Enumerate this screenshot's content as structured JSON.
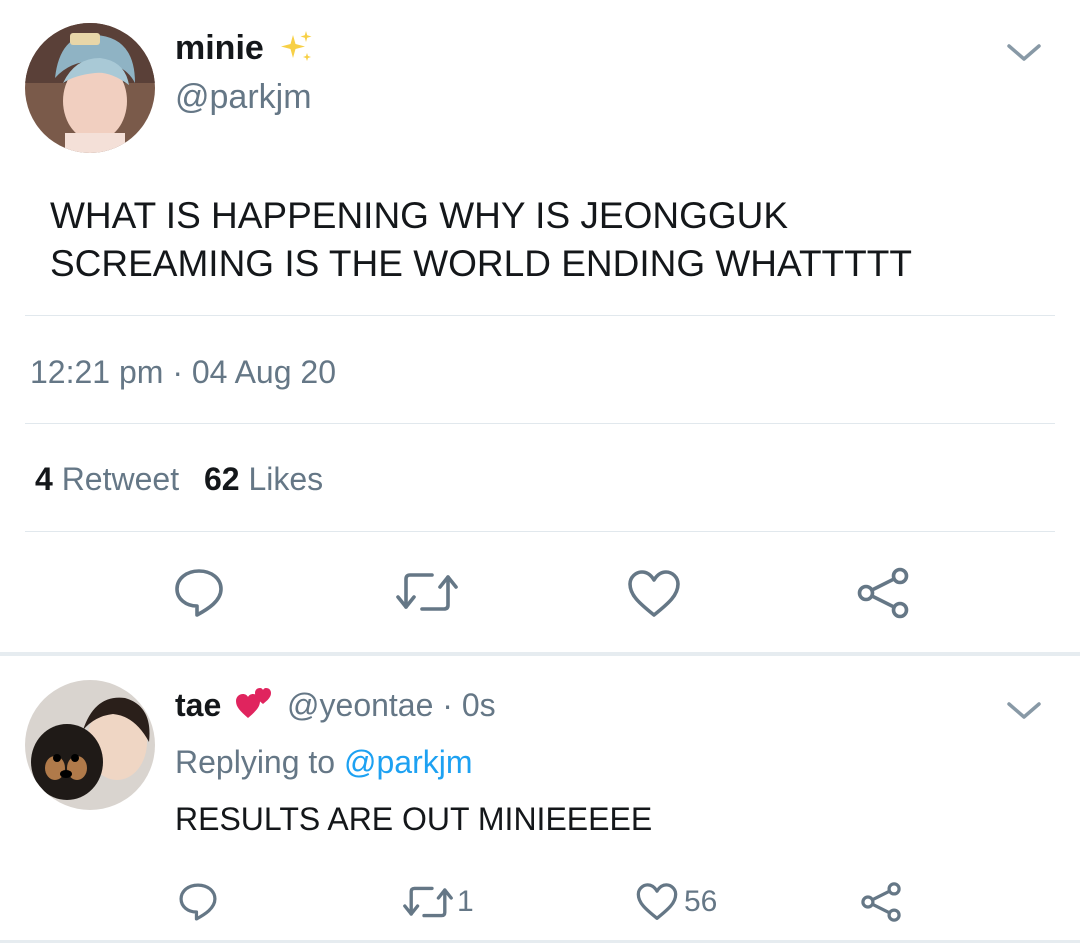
{
  "main_tweet": {
    "display_name": "minie",
    "badge_icon": "sparkles-icon",
    "handle": "@parkjm",
    "text_line1": "WHAT IS HAPPENING WHY IS JEONGGUK",
    "text_line2": "SCREAMING IS THE WORLD ENDING WHATTTTT",
    "timestamp": "12:21 pm · 04 Aug 20",
    "retweet_count": "4",
    "retweet_label": "Retweet",
    "like_count": "62",
    "like_label": "Likes",
    "actions": [
      "reply-icon",
      "retweet-icon",
      "heart-icon",
      "share-icon"
    ]
  },
  "reply_tweet": {
    "display_name": "tae",
    "badge_icon": "two-hearts-icon",
    "handle_time": "@yeontae · 0s",
    "replying_prefix": "Replying to",
    "replying_handle": "@parkjm",
    "text": "RESULTS ARE OUT MINIEEEEE",
    "retweet_count": "1",
    "like_count": "56"
  },
  "colors": {
    "text": "#14171a",
    "muted": "#657786",
    "link": "#1da1f2",
    "divider": "#e1e8ed"
  }
}
